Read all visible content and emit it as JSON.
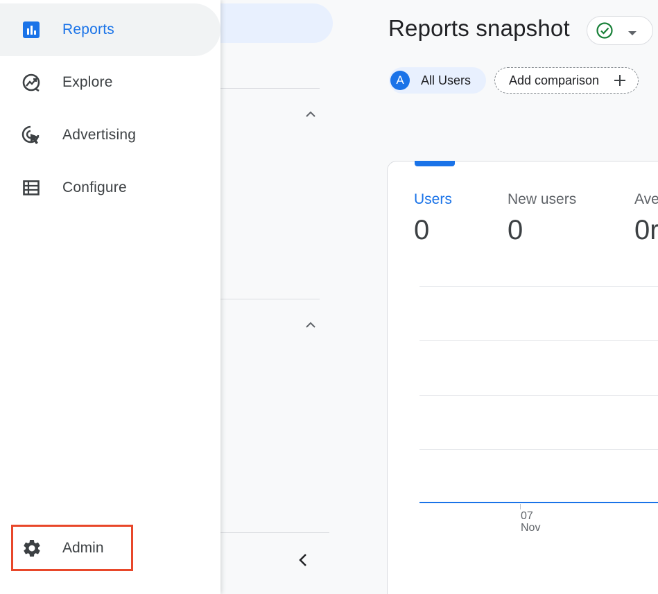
{
  "nav": {
    "items": [
      {
        "label": "Reports",
        "icon": "bar-chart-icon",
        "active": true
      },
      {
        "label": "Explore",
        "icon": "explore-icon",
        "active": false
      },
      {
        "label": "Advertising",
        "icon": "advertising-icon",
        "active": false
      },
      {
        "label": "Configure",
        "icon": "configure-icon",
        "active": false
      }
    ],
    "admin": {
      "label": "Admin",
      "icon": "gear-icon",
      "highlight_color": "#e8472a"
    }
  },
  "header": {
    "title": "Reports snapshot",
    "status_icon": "check-circle-icon"
  },
  "comparison": {
    "segment_avatar": "A",
    "segment_label": "All Users",
    "add_label": "Add comparison"
  },
  "card": {
    "metrics": [
      {
        "label": "Users",
        "value": "0",
        "active": true
      },
      {
        "label": "New users",
        "value": "0",
        "active": false
      },
      {
        "label": "Ave",
        "value": "0r",
        "active": false
      }
    ],
    "x_tick_day": "07",
    "x_tick_month": "Nov"
  },
  "colors": {
    "accent": "#1a73e8",
    "status_green": "#188038",
    "chip_bg": "#e8f0fe"
  }
}
